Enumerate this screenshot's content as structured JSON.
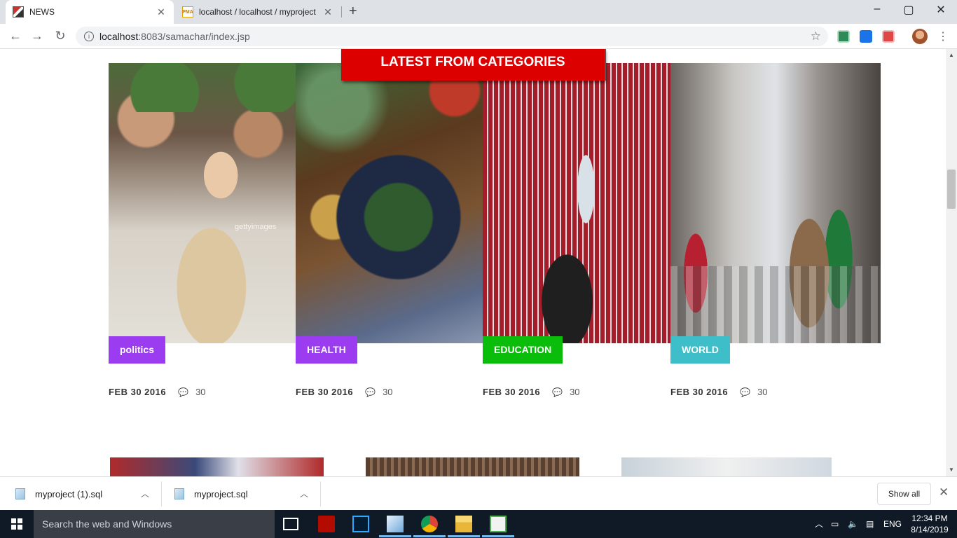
{
  "browser": {
    "tabs": [
      {
        "title": "NEWS",
        "active": true
      },
      {
        "title": "localhost / localhost / myproject",
        "active": false
      }
    ],
    "window_controls": {
      "minimize": "–",
      "maximize": "▢",
      "close": "✕"
    },
    "url_host": "localhost",
    "url_rest": ":8083/samachar/index.jsp"
  },
  "page": {
    "banner_title": "LATEST FROM CATEGORIES",
    "watermark": "gettyimages",
    "cards": [
      {
        "category": "politics",
        "badge_color": "#9b3cf0",
        "date": "FEB 30  2016",
        "comments": "30",
        "image": "group-photo"
      },
      {
        "category": "HEALTH",
        "badge_color": "#9b3cf0",
        "date": "FEB 30  2016",
        "comments": "30",
        "image": "food-bowl"
      },
      {
        "category": "EDUCATION",
        "badge_color": "#0bbd0b",
        "date": "FEB 30  2016",
        "comments": "30",
        "image": "rugby-lineout"
      },
      {
        "category": "WORLD",
        "badge_color": "#3dbec8",
        "date": "FEB 30  2016",
        "comments": "30",
        "image": "city-street"
      }
    ]
  },
  "downloads": {
    "items": [
      {
        "filename": "myproject (1).sql"
      },
      {
        "filename": "myproject.sql"
      }
    ],
    "show_all_label": "Show all"
  },
  "taskbar": {
    "search_placeholder": "Search the web and Windows",
    "language": "ENG",
    "time": "12:34 PM",
    "date": "8/14/2019"
  },
  "colors": {
    "banner": "#dd0000",
    "taskbar": "#101a27"
  }
}
